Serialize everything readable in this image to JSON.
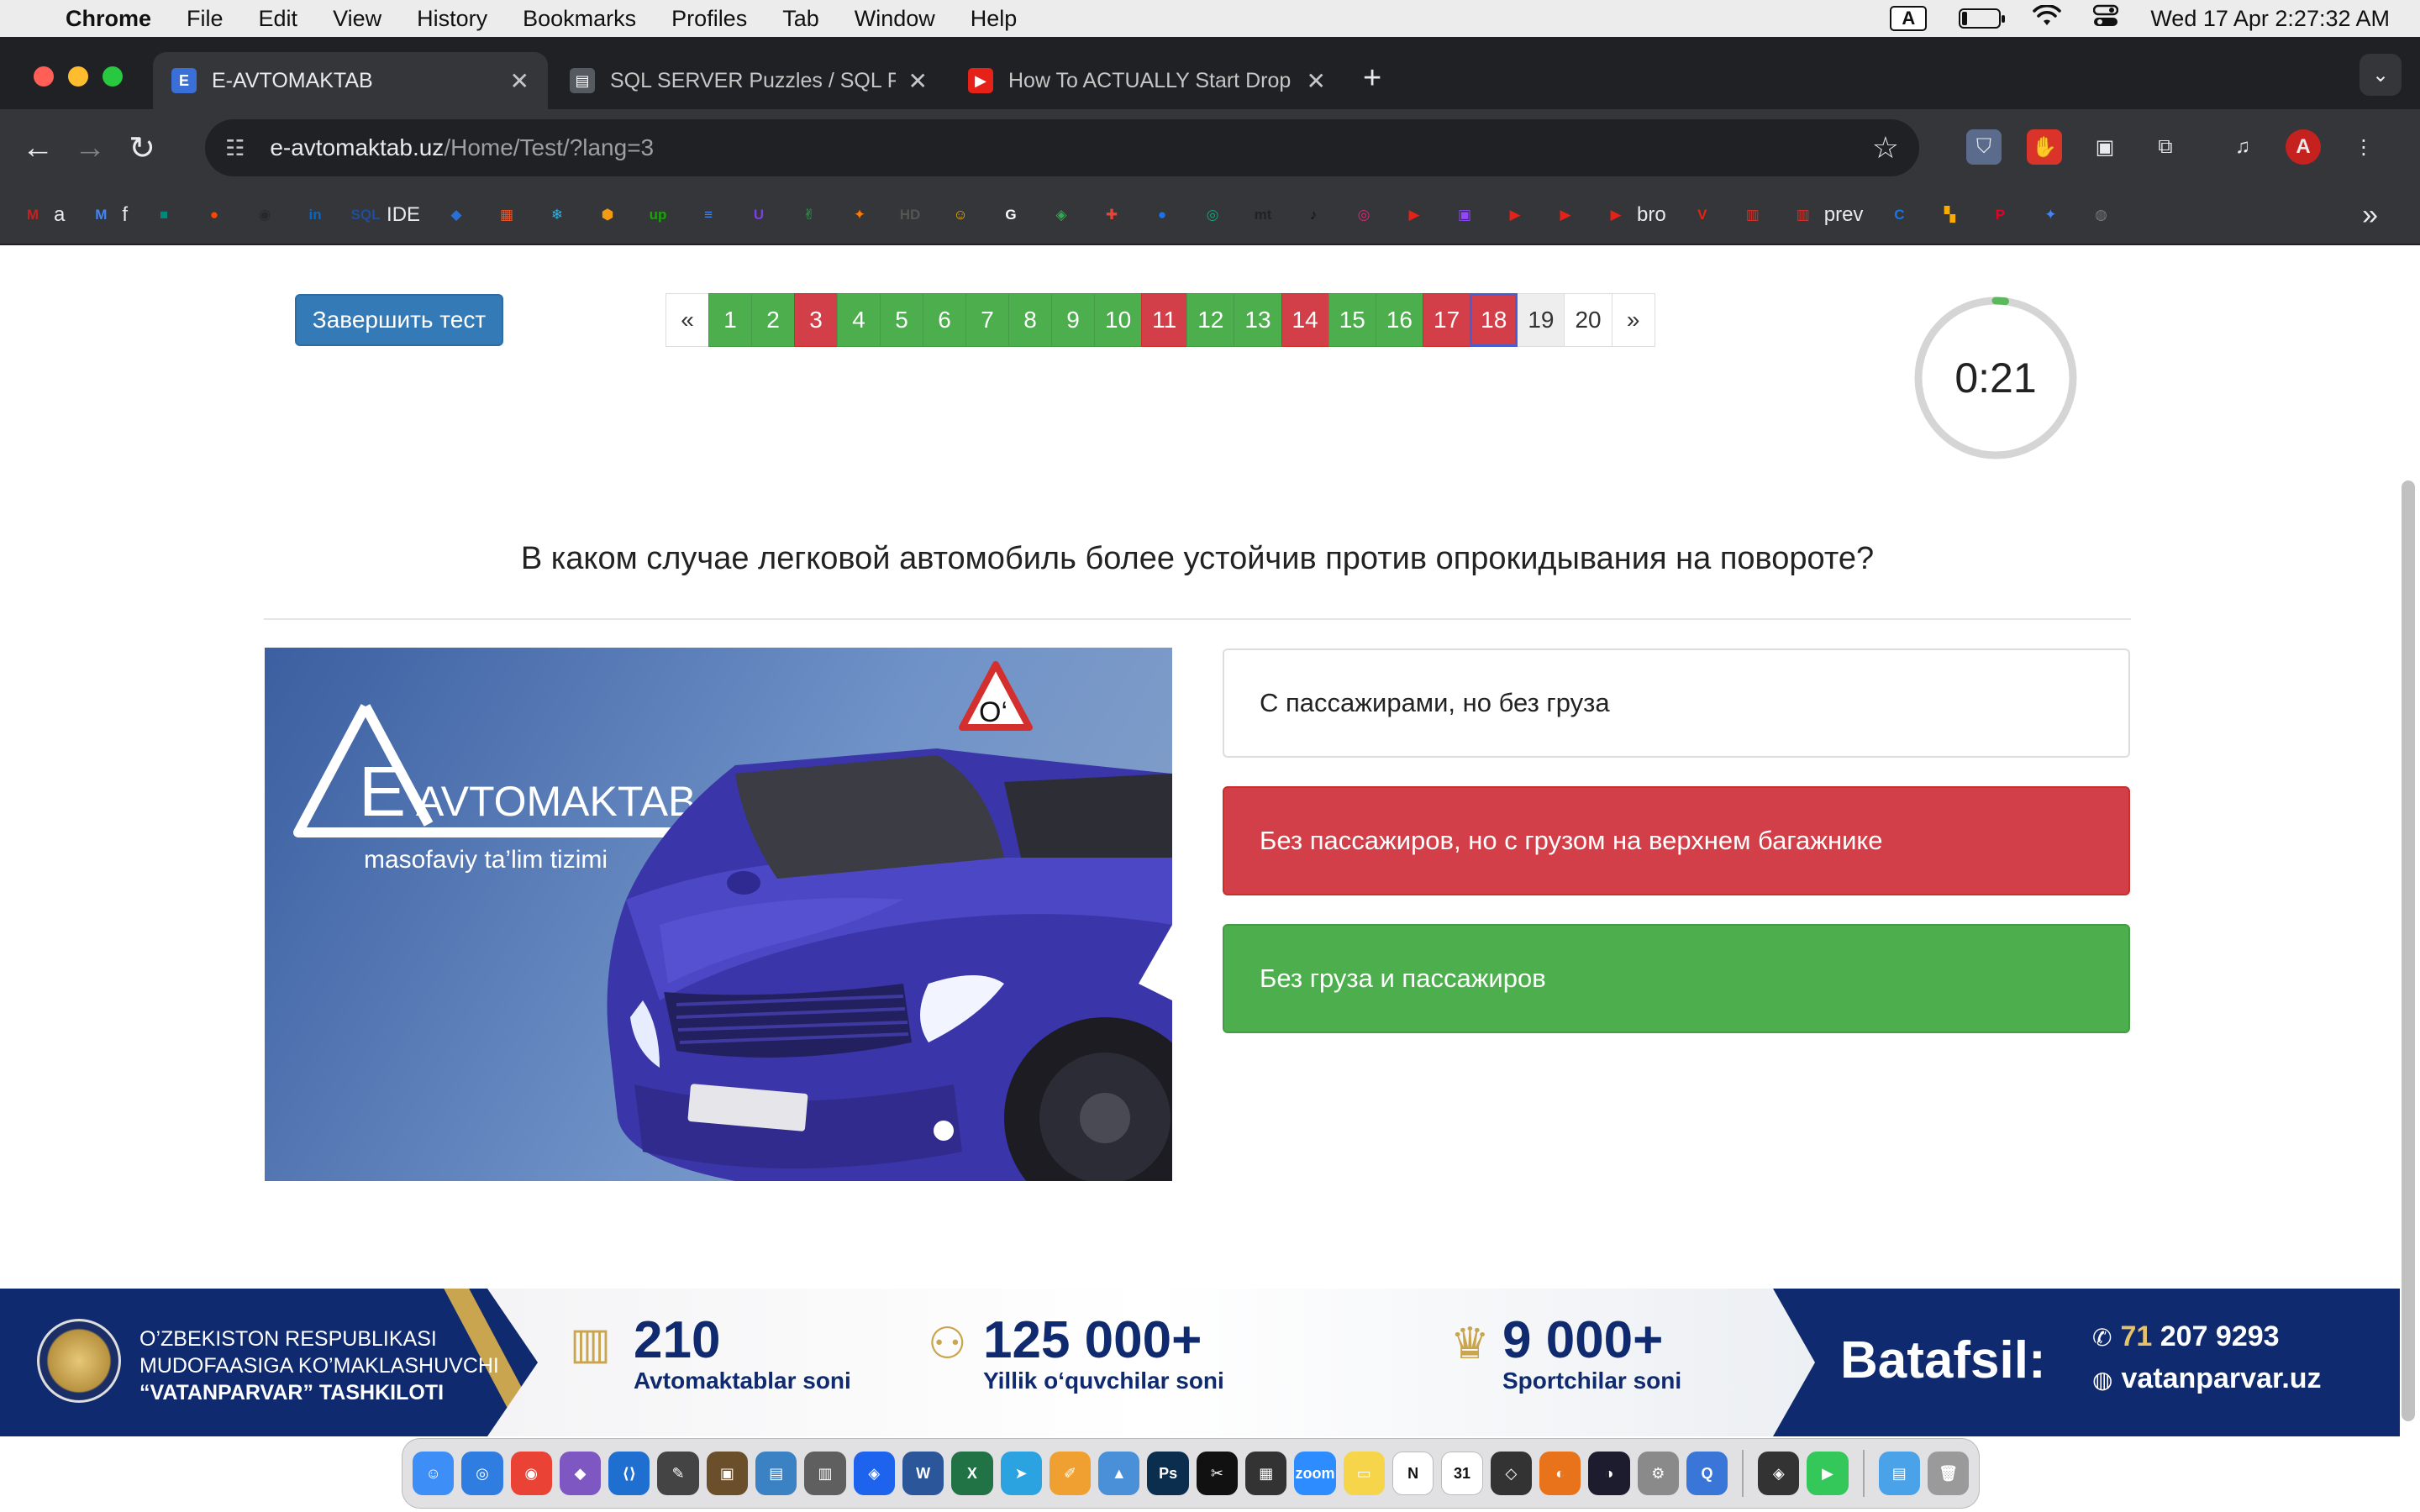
{
  "menubar": {
    "app": "Chrome",
    "items": [
      "File",
      "Edit",
      "View",
      "History",
      "Bookmarks",
      "Profiles",
      "Tab",
      "Window",
      "Help"
    ],
    "input_source": "A",
    "datetime": "Wed 17 Apr  2:27:32 AM"
  },
  "tabs": [
    {
      "title": "E-AVTOMAKTAB",
      "active": true,
      "favicon": "E",
      "favicon_color": "#3b6fd8"
    },
    {
      "title": "SQL SERVER Puzzles / SQL P",
      "active": false,
      "favicon": "▤",
      "favicon_color": "#555a60"
    },
    {
      "title": "How To ACTUALLY Start Drop",
      "active": false,
      "favicon": "▶",
      "favicon_color": "#e62117"
    }
  ],
  "omnibox": {
    "host": "e-avtomaktab.uz",
    "path": "/Home/Test/?lang=3"
  },
  "bookmarks": [
    {
      "icon": "M",
      "color": "#c5221f",
      "label": "a"
    },
    {
      "icon": "M",
      "color": "#4285f4",
      "label": "f"
    },
    {
      "icon": "■",
      "color": "#00897b",
      "label": ""
    },
    {
      "icon": "●",
      "color": "#ff4500",
      "label": ""
    },
    {
      "icon": "◉",
      "color": "#24292e",
      "label": ""
    },
    {
      "icon": "in",
      "color": "#0a66c2",
      "label": ""
    },
    {
      "icon": "SQL",
      "color": "#1f4e9a",
      "label": "IDE"
    },
    {
      "icon": "◆",
      "color": "#2a6fd6",
      "label": ""
    },
    {
      "icon": "▦",
      "color": "#f35325",
      "label": ""
    },
    {
      "icon": "❄",
      "color": "#29b5e8",
      "label": ""
    },
    {
      "icon": "⬢",
      "color": "#f39c12",
      "label": ""
    },
    {
      "icon": "up",
      "color": "#14a800",
      "label": ""
    },
    {
      "icon": "≡",
      "color": "#4285f4",
      "label": ""
    },
    {
      "icon": "U",
      "color": "#7b3fe4",
      "label": ""
    },
    {
      "icon": "✌",
      "color": "#2bb24c",
      "label": ""
    },
    {
      "icon": "✦",
      "color": "#ff7a00",
      "label": ""
    },
    {
      "icon": "HD",
      "color": "#555555",
      "label": ""
    },
    {
      "icon": "☺",
      "color": "#f4b400",
      "label": ""
    },
    {
      "icon": "G",
      "color": "#ffffff",
      "label": ""
    },
    {
      "icon": "◈",
      "color": "#34a853",
      "label": ""
    },
    {
      "icon": "✚",
      "color": "#ea4335",
      "label": ""
    },
    {
      "icon": "●",
      "color": "#1a73e8",
      "label": ""
    },
    {
      "icon": "◎",
      "color": "#10a37f",
      "label": ""
    },
    {
      "icon": "mt",
      "color": "#222222",
      "label": ""
    },
    {
      "icon": "♪",
      "color": "#111111",
      "label": ""
    },
    {
      "icon": "◎",
      "color": "#d62976",
      "label": ""
    },
    {
      "icon": "▶",
      "color": "#e62117",
      "label": ""
    },
    {
      "icon": "▣",
      "color": "#9146ff",
      "label": ""
    },
    {
      "icon": "▶",
      "color": "#e62117",
      "label": ""
    },
    {
      "icon": "▶",
      "color": "#e62117",
      "label": ""
    },
    {
      "icon": "▶",
      "color": "#e62117",
      "label": "bro"
    },
    {
      "icon": "V",
      "color": "#e62117",
      "label": ""
    },
    {
      "icon": "▥",
      "color": "#d93025",
      "label": ""
    },
    {
      "icon": "▥",
      "color": "#d93025",
      "label": "prev"
    },
    {
      "icon": "C",
      "color": "#1a73e8",
      "label": ""
    },
    {
      "icon": "▚",
      "color": "#f9ab00",
      "label": ""
    },
    {
      "icon": "P",
      "color": "#e60023",
      "label": ""
    },
    {
      "icon": "✦",
      "color": "#4285f4",
      "label": ""
    },
    {
      "icon": "◍",
      "color": "#777777",
      "label": ""
    }
  ],
  "test": {
    "finish_label": "Завершить тест",
    "pager": {
      "prev": "«",
      "next": "»",
      "pages": [
        {
          "n": "1",
          "state": "green"
        },
        {
          "n": "2",
          "state": "green"
        },
        {
          "n": "3",
          "state": "red"
        },
        {
          "n": "4",
          "state": "green"
        },
        {
          "n": "5",
          "state": "green"
        },
        {
          "n": "6",
          "state": "green"
        },
        {
          "n": "7",
          "state": "green"
        },
        {
          "n": "8",
          "state": "green"
        },
        {
          "n": "9",
          "state": "green"
        },
        {
          "n": "10",
          "state": "green"
        },
        {
          "n": "11",
          "state": "red"
        },
        {
          "n": "12",
          "state": "green"
        },
        {
          "n": "13",
          "state": "green"
        },
        {
          "n": "14",
          "state": "red"
        },
        {
          "n": "15",
          "state": "green"
        },
        {
          "n": "16",
          "state": "green"
        },
        {
          "n": "17",
          "state": "red"
        },
        {
          "n": "18",
          "state": "red current"
        },
        {
          "n": "19",
          "state": "grey"
        },
        {
          "n": "20",
          "state": "neutral"
        }
      ]
    },
    "timer": "0:21",
    "timer_fraction_elapsed": 0.02,
    "question": "В каком случае легковой автомобиль более устойчив против опрокидывания на повороте?",
    "image": {
      "brand_letter": "E",
      "brand_name": "AVTOMAKTAB",
      "tagline": "masofaviy ta’lim tizimi",
      "roof_sign": "O‘"
    },
    "answers": [
      {
        "text": "С пассажирами, но без груза",
        "state": "neutral"
      },
      {
        "text": "Без пассажиров, но с грузом на верхнем багажнике",
        "state": "wrong"
      },
      {
        "text": "Без груза и пассажиров",
        "state": "correct"
      }
    ]
  },
  "banner": {
    "org_line1": "O’ZBEKISTON RESPUBLIKASI",
    "org_line2": "MUDOFAASIGA KO’MAKLASHUVCHI",
    "org_line3": "“VATANPARVAR” TASHKILOTI",
    "stats": [
      {
        "num": "210",
        "label": "Avtomaktablar soni",
        "icon": "building-icon"
      },
      {
        "num": "125 000+",
        "label": "Yillik o‘quvchilar soni",
        "icon": "people-icon"
      },
      {
        "num": "9 000+",
        "label": "Sportchilar soni",
        "icon": "trophy-icon"
      }
    ],
    "cta": "Batafsil:",
    "phone_code": "71",
    "phone": "207 9293",
    "site": "vatanparvar.uz"
  },
  "dock": [
    {
      "icon": "☺",
      "color": "#3d8ef7"
    },
    {
      "icon": "◎",
      "color": "#2f7de1"
    },
    {
      "icon": "◉",
      "color": "#ea4335"
    },
    {
      "icon": "◆",
      "color": "#7e57c2"
    },
    {
      "icon": "⟨⟩",
      "color": "#1f6fd1"
    },
    {
      "icon": "✎",
      "color": "#444444"
    },
    {
      "icon": "▣",
      "color": "#6b4f2a"
    },
    {
      "icon": "▤",
      "color": "#3b82c4"
    },
    {
      "icon": "▥",
      "color": "#5f5f5f"
    },
    {
      "icon": "◈",
      "color": "#1d63ed"
    },
    {
      "icon": "W",
      "color": "#2b579a"
    },
    {
      "icon": "X",
      "color": "#217346"
    },
    {
      "icon": "➤",
      "color": "#2aa3e0"
    },
    {
      "icon": "✐",
      "color": "#f0a030"
    },
    {
      "icon": "▲",
      "color": "#4a90d9"
    },
    {
      "icon": "Ps",
      "color": "#0b2e4f"
    },
    {
      "icon": "✂",
      "color": "#111111"
    },
    {
      "icon": "▦",
      "color": "#333333"
    },
    {
      "icon": "zoom",
      "color": "#2d8cff"
    },
    {
      "icon": "▭",
      "color": "#f7d54a"
    },
    {
      "icon": "N",
      "color": "#ffffff"
    },
    {
      "icon": "31",
      "color": "#ffffff"
    },
    {
      "icon": "◇",
      "color": "#333333"
    },
    {
      "icon": "◐",
      "color": "#e8731a"
    },
    {
      "icon": "◑",
      "color": "#1c1c2e"
    },
    {
      "icon": "⚙",
      "color": "#8a8a8a"
    },
    {
      "icon": "Q",
      "color": "#3a76d8"
    },
    {
      "icon": "◈",
      "color": "#333333"
    },
    {
      "icon": "▶",
      "color": "#34c759"
    },
    {
      "icon": "▤",
      "color": "#4aa3e8"
    },
    {
      "icon": "🗑",
      "color": "#9a9a9a"
    }
  ]
}
